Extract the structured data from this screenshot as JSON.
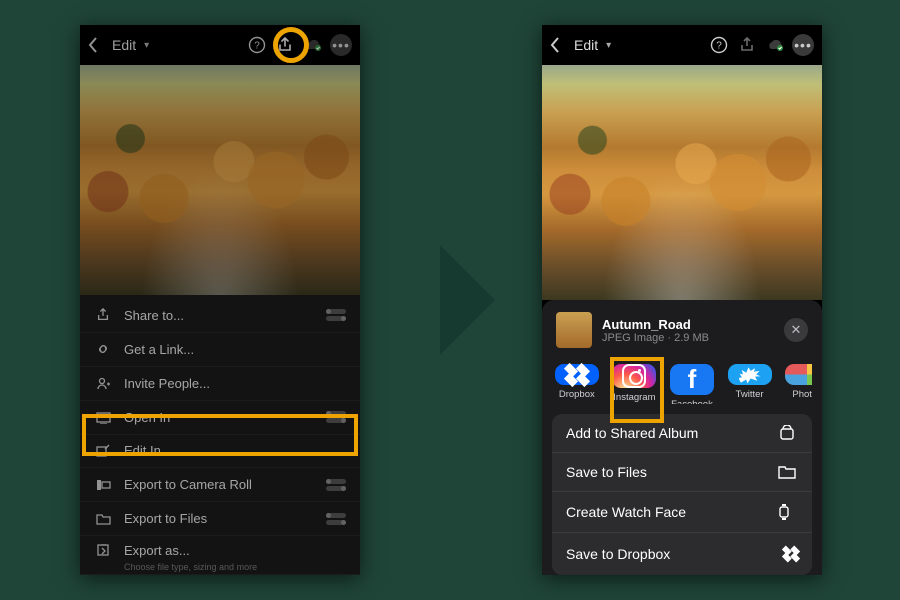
{
  "highlight_color": "#eda400",
  "left": {
    "topbar": {
      "title": "Edit"
    },
    "menu": [
      {
        "key": "share",
        "label": "Share to...",
        "toggle": true
      },
      {
        "key": "link",
        "label": "Get a Link..."
      },
      {
        "key": "invite",
        "label": "Invite People..."
      },
      {
        "key": "openin",
        "label": "Open In",
        "toggle": true,
        "highlight": true
      },
      {
        "key": "editin",
        "label": "Edit In"
      },
      {
        "key": "camroll",
        "label": "Export to Camera Roll",
        "toggle": true
      },
      {
        "key": "files",
        "label": "Export to Files",
        "toggle": true
      },
      {
        "key": "exportas",
        "label": "Export as...",
        "sub": "Choose file type, sizing and more"
      }
    ]
  },
  "right": {
    "topbar": {
      "title": "Edit"
    },
    "file": {
      "name": "Autumn_Road",
      "meta": "JPEG Image · 2.9 MB"
    },
    "apps": [
      {
        "key": "dropbox",
        "label": "Dropbox"
      },
      {
        "key": "instagram",
        "label": "Instagram",
        "highlight": true
      },
      {
        "key": "facebook",
        "label": "Facebook"
      },
      {
        "key": "twitter",
        "label": "Twitter"
      },
      {
        "key": "photos",
        "label": "Photos"
      }
    ],
    "actions": [
      {
        "key": "sharedalbum",
        "label": "Add to Shared Album"
      },
      {
        "key": "savefiles",
        "label": "Save to Files"
      },
      {
        "key": "watchface",
        "label": "Create Watch Face"
      },
      {
        "key": "savedropbox",
        "label": "Save to Dropbox"
      }
    ]
  }
}
